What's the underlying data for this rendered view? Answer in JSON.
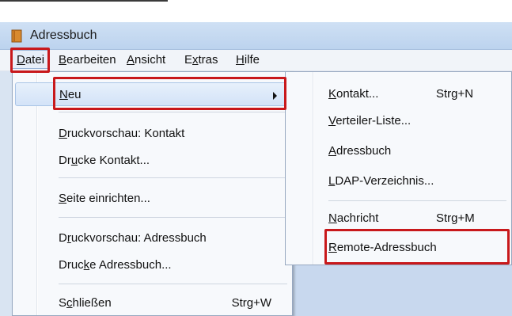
{
  "window": {
    "title": "Adressbuch",
    "icon": "address-book-icon"
  },
  "menubar": [
    {
      "pre": "",
      "u": "D",
      "post": "atei"
    },
    {
      "pre": "",
      "u": "B",
      "post": "earbeiten"
    },
    {
      "pre": "",
      "u": "A",
      "post": "nsicht"
    },
    {
      "pre": "E",
      "u": "x",
      "post": "tras"
    },
    {
      "pre": "",
      "u": "H",
      "post": "ilfe"
    }
  ],
  "file_menu": {
    "neu": {
      "pre": "",
      "u": "N",
      "post": "eu"
    },
    "druckvorschau_kontakt": {
      "pre": "",
      "u": "D",
      "post": "ruckvorschau: Kontakt"
    },
    "drucke_kontakt": {
      "pre": "Dr",
      "u": "u",
      "post": "cke Kontakt..."
    },
    "seite_einrichten": {
      "pre": "",
      "u": "S",
      "post": "eite einrichten..."
    },
    "druckvorschau_adressbuch": {
      "pre": "D",
      "u": "r",
      "post": "uckvorschau: Adressbuch"
    },
    "drucke_adressbuch": {
      "pre": "Druc",
      "u": "k",
      "post": "e Adressbuch..."
    },
    "schliessen": {
      "pre": "S",
      "u": "c",
      "post": "hließen",
      "shortcut": "Strg+W"
    }
  },
  "new_submenu": {
    "kontakt": {
      "pre": "",
      "u": "K",
      "post": "ontakt...",
      "shortcut": "Strg+N"
    },
    "verteiler": {
      "pre": "",
      "u": "V",
      "post": "erteiler-Liste..."
    },
    "adressbuch": {
      "pre": "",
      "u": "A",
      "post": "dressbuch"
    },
    "ldap": {
      "pre": "",
      "u": "L",
      "post": "DAP-Verzeichnis..."
    },
    "nachricht": {
      "pre": "",
      "u": "N",
      "post": "achricht",
      "shortcut": "Strg+M"
    },
    "remote": {
      "pre": "",
      "u": "R",
      "post": "emote-Adressbuch"
    }
  },
  "colors": {
    "highlight_box": "#c8181b",
    "titlebar": "#c6daf1",
    "menu_bg": "#f7f9fc"
  }
}
